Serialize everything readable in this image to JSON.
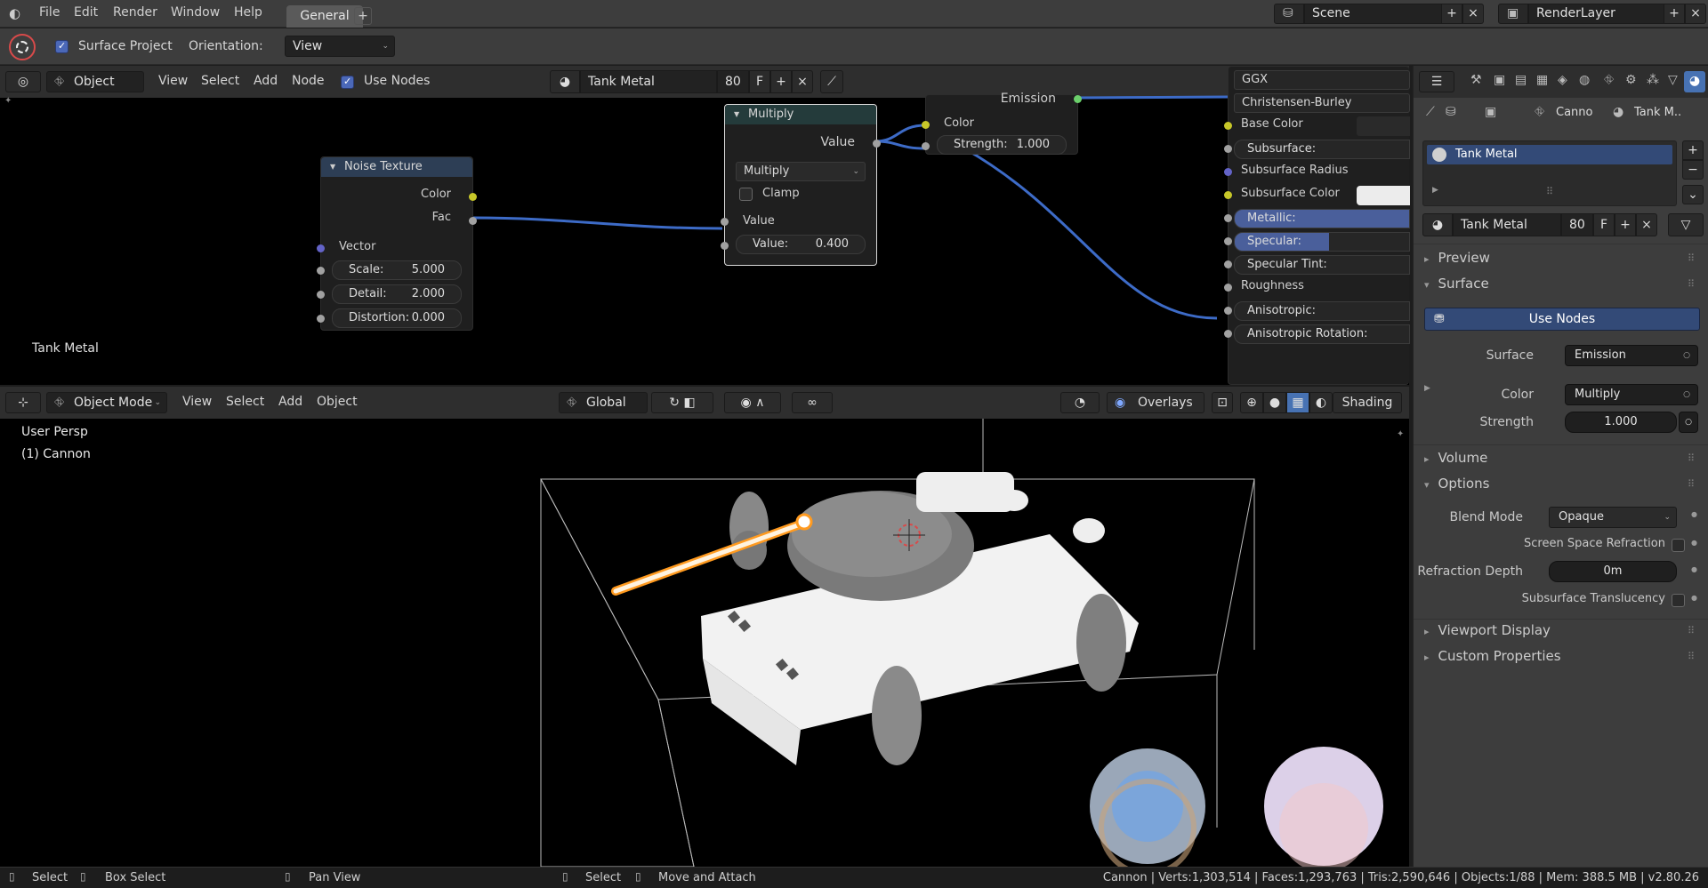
{
  "menu": {
    "file": "File",
    "edit": "Edit",
    "render": "Render",
    "window": "Window",
    "help": "Help"
  },
  "workspace_tab": "General",
  "scene": {
    "name": "Scene",
    "renderlayer": "RenderLayer"
  },
  "tool": {
    "surface_project": "Surface Project",
    "orientation_label": "Orientation:",
    "orientation_value": "View"
  },
  "node_editor": {
    "editor_type": "Object",
    "view": "View",
    "select": "Select",
    "add": "Add",
    "node": "Node",
    "use_nodes": "Use Nodes",
    "material_name": "Tank Metal",
    "users": "80",
    "fake": "F",
    "label_bottom": "Tank Metal",
    "noise": {
      "title": "Noise Texture",
      "color": "Color",
      "fac": "Fac",
      "vector": "Vector",
      "scale_label": "Scale:",
      "scale": "5.000",
      "detail_label": "Detail:",
      "detail": "2.000",
      "distortion_label": "Distortion:",
      "distortion": "0.000"
    },
    "multiply": {
      "title": "Multiply",
      "value_out": "Value",
      "op": "Multiply",
      "clamp": "Clamp",
      "value_in": "Value",
      "value_label": "Value:",
      "value": "0.400"
    },
    "emission": {
      "emission": "Emission",
      "color": "Color",
      "strength_label": "Strength:",
      "strength": "1.000"
    },
    "principled": {
      "distribution": "GGX",
      "subsurface_method": "Christensen-Burley",
      "base_color": "Base Color",
      "subsurface": "Subsurface:",
      "subsurface_radius": "Subsurface Radius",
      "subsurface_color": "Subsurface Color",
      "metallic": "Metallic:",
      "specular": "Specular:",
      "specular_tint": "Specular Tint:",
      "roughness": "Roughness",
      "anisotropic": "Anisotropic:",
      "anisotropic_rotation": "Anisotropic Rotation:"
    }
  },
  "viewport": {
    "mode": "Object Mode",
    "view": "View",
    "select": "Select",
    "add": "Add",
    "object": "Object",
    "orientation": "Global",
    "overlays": "Overlays",
    "shading": "Shading",
    "persp": "User Persp",
    "active": "(1) Cannon"
  },
  "properties": {
    "breadcrumb_obj": "Canno",
    "breadcrumb_mat": "Tank M..",
    "slot_name": "Tank Metal",
    "material_name": "Tank Metal",
    "users": "80",
    "fake": "F",
    "sections": {
      "preview": "Preview",
      "surface": "Surface",
      "volume": "Volume",
      "options": "Options",
      "viewport_display": "Viewport Display",
      "custom_properties": "Custom Properties"
    },
    "use_nodes": "Use Nodes",
    "surface_label": "Surface",
    "surface_value": "Emission",
    "color_label": "Color",
    "color_value": "Multiply",
    "strength_label": "Strength",
    "strength_value": "1.000",
    "blend_label": "Blend Mode",
    "blend_value": "Opaque",
    "ssr_label": "Screen Space Refraction",
    "refr_label": "Refraction Depth",
    "refr_value": "0m",
    "sst_label": "Subsurface Translucency"
  },
  "status": {
    "select": "Select",
    "box_select": "Box Select",
    "pan_view": "Pan View",
    "select2": "Select",
    "move_attach": "Move and Attach",
    "stats": "Cannon | Verts:1,303,514 | Faces:1,293,763 | Tris:2,590,646 | Objects:1/88 | Mem: 388.5 MB | v2.80.26"
  },
  "colors": {
    "accent": "#4772b3",
    "socket_yellow": "#c7c729",
    "socket_grey": "#a1a1a1",
    "socket_blue": "#6363c7",
    "link": "#3d6bc7",
    "orange": "#ff9a1f"
  }
}
